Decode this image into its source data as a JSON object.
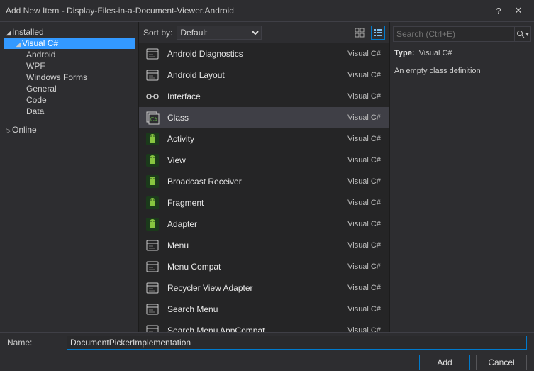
{
  "window": {
    "title": "Add New Item - Display-Files-in-a-Document-Viewer.Android",
    "help": "?",
    "close": "✕"
  },
  "tree": {
    "installed": "Installed",
    "visual_csharp": "Visual C#",
    "children": [
      "Android",
      "WPF",
      "Windows Forms",
      "General",
      "Code",
      "Data"
    ],
    "online": "Online"
  },
  "toolbar": {
    "sortby_label": "Sort by:",
    "sortby_value": "Default"
  },
  "items": [
    {
      "name": "Android Diagnostics",
      "lang": "Visual C#",
      "icon": "form"
    },
    {
      "name": "Android Layout",
      "lang": "Visual C#",
      "icon": "form"
    },
    {
      "name": "Interface",
      "lang": "Visual C#",
      "icon": "interface"
    },
    {
      "name": "Class",
      "lang": "Visual C#",
      "icon": "class",
      "selected": true
    },
    {
      "name": "Activity",
      "lang": "Visual C#",
      "icon": "android"
    },
    {
      "name": "View",
      "lang": "Visual C#",
      "icon": "android"
    },
    {
      "name": "Broadcast Receiver",
      "lang": "Visual C#",
      "icon": "android"
    },
    {
      "name": "Fragment",
      "lang": "Visual C#",
      "icon": "android"
    },
    {
      "name": "Adapter",
      "lang": "Visual C#",
      "icon": "android"
    },
    {
      "name": "Menu",
      "lang": "Visual C#",
      "icon": "form"
    },
    {
      "name": "Menu Compat",
      "lang": "Visual C#",
      "icon": "form"
    },
    {
      "name": "Recycler View Adapter",
      "lang": "Visual C#",
      "icon": "form"
    },
    {
      "name": "Search Menu",
      "lang": "Visual C#",
      "icon": "form"
    },
    {
      "name": "Search Menu AppCompat",
      "lang": "Visual C#",
      "icon": "form"
    }
  ],
  "search": {
    "placeholder": "Search (Ctrl+E)"
  },
  "details": {
    "type_label": "Type:",
    "type_value": "Visual C#",
    "description": "An empty class definition"
  },
  "name_field": {
    "label": "Name:",
    "value": "DocumentPickerImplementation"
  },
  "buttons": {
    "add": "Add",
    "cancel": "Cancel"
  }
}
